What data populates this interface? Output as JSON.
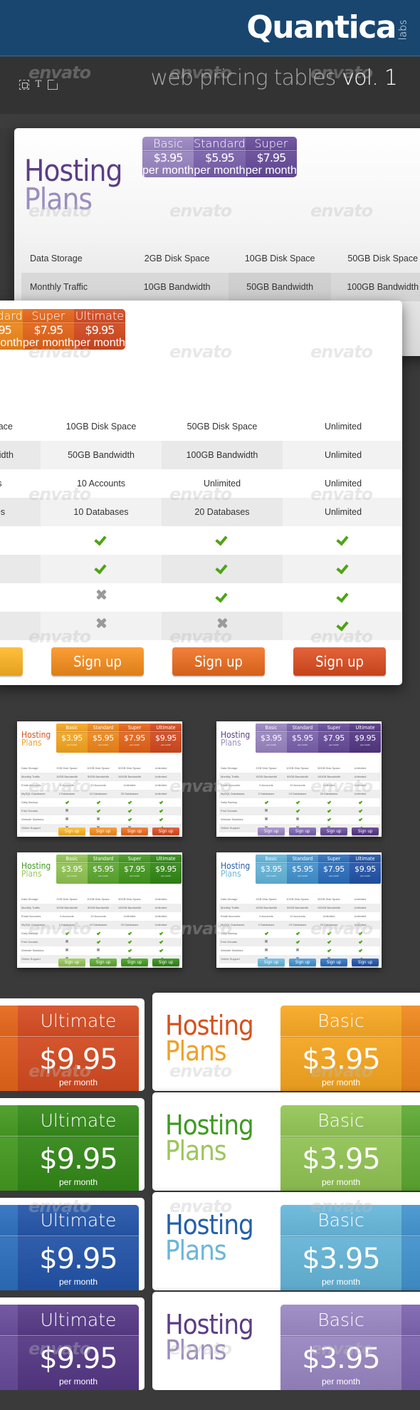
{
  "header": {
    "brand": "Quantica",
    "brand_sub": "labs",
    "tools": [
      "frame-icon",
      "text-tool-icon",
      "shape-icon"
    ],
    "subtitle": "web pricing tables",
    "subtitle_vol": "vol. 1",
    "bg_color": "#19466f"
  },
  "watermark": "envato",
  "title": {
    "line1": "Hosting",
    "line2": "Plans"
  },
  "plans": [
    {
      "name": "Basic",
      "price": "$3.95",
      "period": "per month",
      "signup": "Sign up"
    },
    {
      "name": "Standard",
      "price": "$5.95",
      "period": "per month",
      "signup": "Sign up"
    },
    {
      "name": "Super",
      "price": "$7.95",
      "period": "per month",
      "signup": "Sign up"
    },
    {
      "name": "Ultimate",
      "price": "$9.95",
      "period": "per month",
      "signup": "Sign up"
    }
  ],
  "features": [
    {
      "label": "Data Storage",
      "values": [
        "2GB Disk Space",
        "10GB Disk Space",
        "50GB Disk Space",
        "Unlimited"
      ]
    },
    {
      "label": "Monthly Traffic",
      "values": [
        "10GB Bandwidth",
        "50GB Bandwidth",
        "100GB Bandwidth",
        "Unlimited"
      ]
    },
    {
      "label": "Email Accounts",
      "values": [
        "5 Accounts",
        "10 Accounts",
        "Unlimited",
        "Unlimited"
      ]
    },
    {
      "label": "MySQL Databases",
      "values": [
        "2 Databases",
        "10 Databases",
        "20 Databases",
        "Unlimited"
      ]
    },
    {
      "label": "Daily Backup",
      "values": [
        true,
        true,
        true,
        true
      ]
    },
    {
      "label": "Free Domain",
      "values": [
        false,
        true,
        true,
        true
      ]
    },
    {
      "label": "Website Statistics",
      "values": [
        false,
        false,
        true,
        true
      ]
    },
    {
      "label": "Online Support",
      "values": [
        false,
        false,
        false,
        true
      ]
    }
  ],
  "themes": {
    "orange": {
      "title1": "#d4521e",
      "title2": "#f0a02a",
      "cols": [
        "#f0a62a",
        "#ea8a26",
        "#e06a24",
        "#d0512a"
      ],
      "btns": [
        "#f2b02e",
        "#ec8e28",
        "#e2702a",
        "#d4532a"
      ]
    },
    "purple": {
      "title1": "#5b3d86",
      "title2": "#9c8cbf",
      "cols": [
        "#9a88c0",
        "#7e67ad",
        "#6c539c",
        "#5b4088"
      ],
      "btns": [
        "#9a88c0",
        "#7e67ad",
        "#6c539c",
        "#5b4088"
      ]
    },
    "green": {
      "title1": "#3f9a22",
      "title2": "#9cc65c",
      "cols": [
        "#94c25a",
        "#62a83a",
        "#4b9a2a",
        "#3b8a22"
      ],
      "btns": [
        "#94c25a",
        "#62a83a",
        "#4b9a2a",
        "#3b8a22"
      ]
    },
    "blue": {
      "title1": "#245fab",
      "title2": "#6cb6d8",
      "cols": [
        "#6ab4d6",
        "#4a94cc",
        "#3574bc",
        "#2c5aa8"
      ],
      "btns": [
        "#6ab4d6",
        "#4a94cc",
        "#3574bc",
        "#2c5aa8"
      ]
    }
  }
}
